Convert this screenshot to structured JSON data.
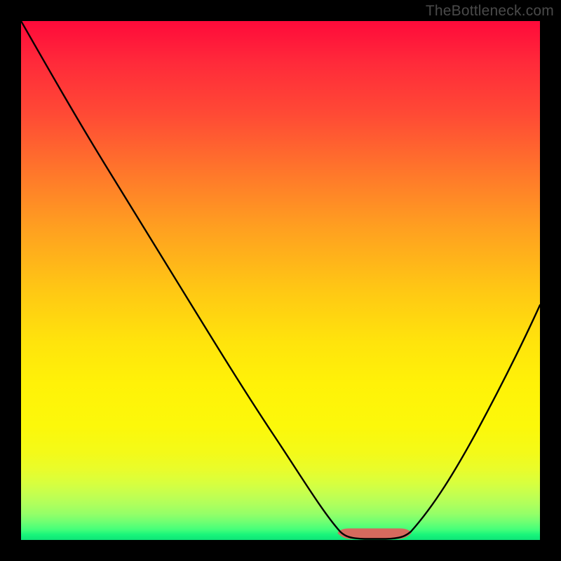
{
  "watermark": "TheBottleneck.com",
  "chart_data": {
    "type": "line",
    "title": "",
    "xlabel": "",
    "ylabel": "",
    "xlim": [
      0,
      100
    ],
    "ylim": [
      0,
      100
    ],
    "grid": false,
    "legend": false,
    "background_gradient": {
      "direction": "vertical",
      "stops": [
        {
          "pos": 0.0,
          "color": "#ff0a3a"
        },
        {
          "pos": 0.3,
          "color": "#ff7a2a"
        },
        {
          "pos": 0.55,
          "color": "#ffd010"
        },
        {
          "pos": 0.8,
          "color": "#f5fa12"
        },
        {
          "pos": 0.92,
          "color": "#b0ff5c"
        },
        {
          "pos": 1.0,
          "color": "#0ee478"
        }
      ]
    },
    "series": [
      {
        "name": "bottleneck-curve",
        "color": "#000000",
        "x": [
          0,
          5,
          10,
          15,
          20,
          25,
          30,
          35,
          40,
          45,
          50,
          55,
          60,
          62,
          64,
          66,
          68,
          70,
          72,
          75,
          80,
          85,
          90,
          95,
          100
        ],
        "y": [
          100,
          92,
          84,
          76,
          68,
          60,
          52,
          44,
          36,
          28,
          20,
          12,
          5,
          2,
          0.5,
          0.3,
          0.3,
          0.5,
          2,
          6,
          14,
          24,
          34,
          45,
          56
        ]
      },
      {
        "name": "sweet-spot-marker",
        "color": "#d56a5e",
        "type": "area",
        "x": [
          61,
          63,
          65,
          67,
          69,
          71,
          73
        ],
        "y": [
          1.3,
          0.5,
          0.3,
          0.3,
          0.3,
          0.5,
          1.3
        ]
      }
    ],
    "annotations": []
  }
}
